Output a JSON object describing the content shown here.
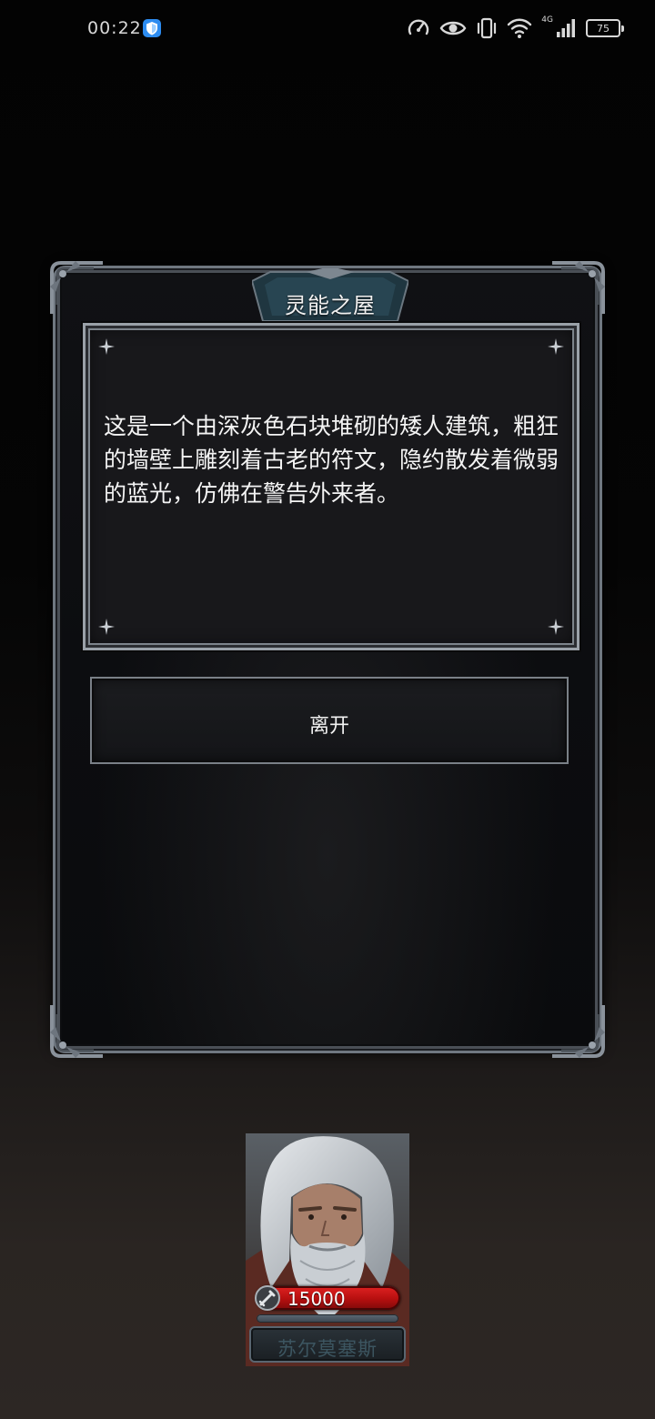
{
  "status_bar": {
    "time": "00:22",
    "network_type": "4G",
    "battery": "75"
  },
  "dialog": {
    "title": "灵能之屋",
    "description": "这是一个由深灰色石块堆砌的矮人建筑，粗狂的墙壁上雕刻着古老的符文，隐约散发着微弱的蓝光，仿佛在警告外来者。",
    "leave_label": "离开"
  },
  "hero": {
    "gold": "15000",
    "name": "苏尔莫塞斯"
  },
  "colors": {
    "frame": "#6f7780",
    "gold_bar": "#c81818",
    "name_text": "#3c5560"
  }
}
